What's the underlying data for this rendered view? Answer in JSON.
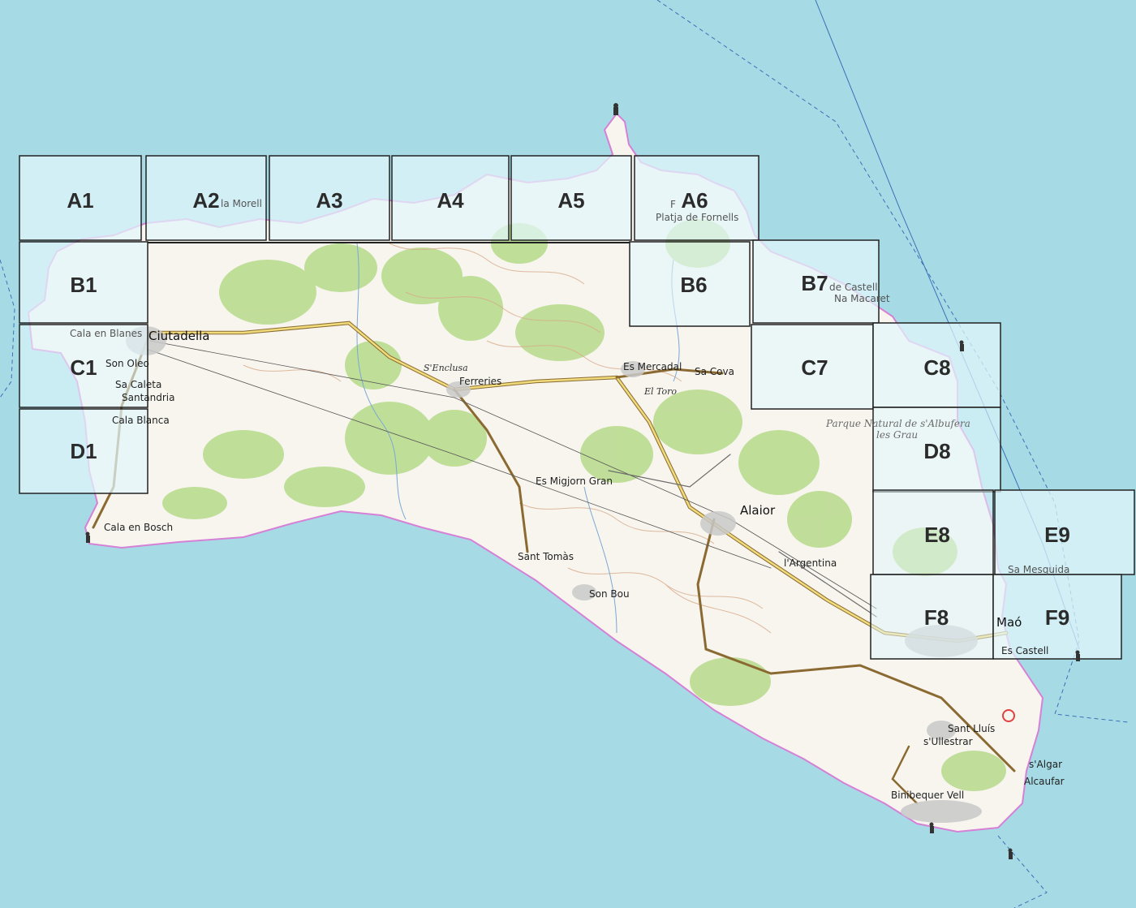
{
  "map": {
    "colors": {
      "sea": "#a6dbe6",
      "land": "#f7f5ee",
      "forest": "#b9dc8f",
      "coast_outline": "#d680d6",
      "road": "#8b6a32",
      "road_fill": "#f0dc7a",
      "contour": "#d8a98a",
      "tile_fill": "#e2f6fb",
      "tile_border": "#222222"
    },
    "tiles": [
      {
        "id": "A1",
        "label": "A1"
      },
      {
        "id": "A2",
        "label": "A2"
      },
      {
        "id": "A3",
        "label": "A3"
      },
      {
        "id": "A4",
        "label": "A4"
      },
      {
        "id": "A5",
        "label": "A5"
      },
      {
        "id": "A6",
        "label": "A6"
      },
      {
        "id": "B1",
        "label": "B1"
      },
      {
        "id": "B6",
        "label": "B6"
      },
      {
        "id": "B7",
        "label": "B7"
      },
      {
        "id": "C1",
        "label": "C1"
      },
      {
        "id": "C7",
        "label": "C7"
      },
      {
        "id": "C8",
        "label": "C8"
      },
      {
        "id": "D1",
        "label": "D1"
      },
      {
        "id": "D8",
        "label": "D8"
      },
      {
        "id": "E8",
        "label": "E8"
      },
      {
        "id": "E9",
        "label": "E9"
      },
      {
        "id": "F8",
        "label": "F8"
      },
      {
        "id": "F9",
        "label": "F9"
      }
    ],
    "places": {
      "ciutadella": "Ciutadella",
      "cala_en_blanes": "Cala en Blanes",
      "son_oleo": "Son Oleo",
      "sa_caleta": "Sa Caleta",
      "santandria": "Santandria",
      "cala_blanca": "Cala Blanca",
      "cala_en_bosch": "Cala en Bosch",
      "la_morell": "la Morell",
      "fornells": "F",
      "platja_de_fornells": "Platja de Fornells",
      "de_castell": "de Castell",
      "na_macaret": "Na Macaret",
      "senclusa": "S'Enclusa",
      "ferreries": "Ferreries",
      "es_mercadal": "Es Mercadal",
      "sa_cova": "Sa Cova",
      "el_toro": "El Toro",
      "es_migjorn_gran": "Es Migjorn Gran",
      "alaior": "Alaior",
      "largentina": "l'Argentina",
      "sant_tomas": "Sant Tomàs",
      "son_bou": "Son Bou",
      "parque_natural": "Parque Natural de s'Albufera",
      "es_grau": "les Grau",
      "sa_mesquida": "Sa Mesquida",
      "mao": "Maó",
      "es_castell": "Es Castell",
      "sant_lluis": "Sant Lluís",
      "sullestrar": "s'Ullestrar",
      "salgar": "s'Algar",
      "alcaufar": "Alcaufar",
      "binibequer_vell": "Binibequer Vell"
    }
  }
}
